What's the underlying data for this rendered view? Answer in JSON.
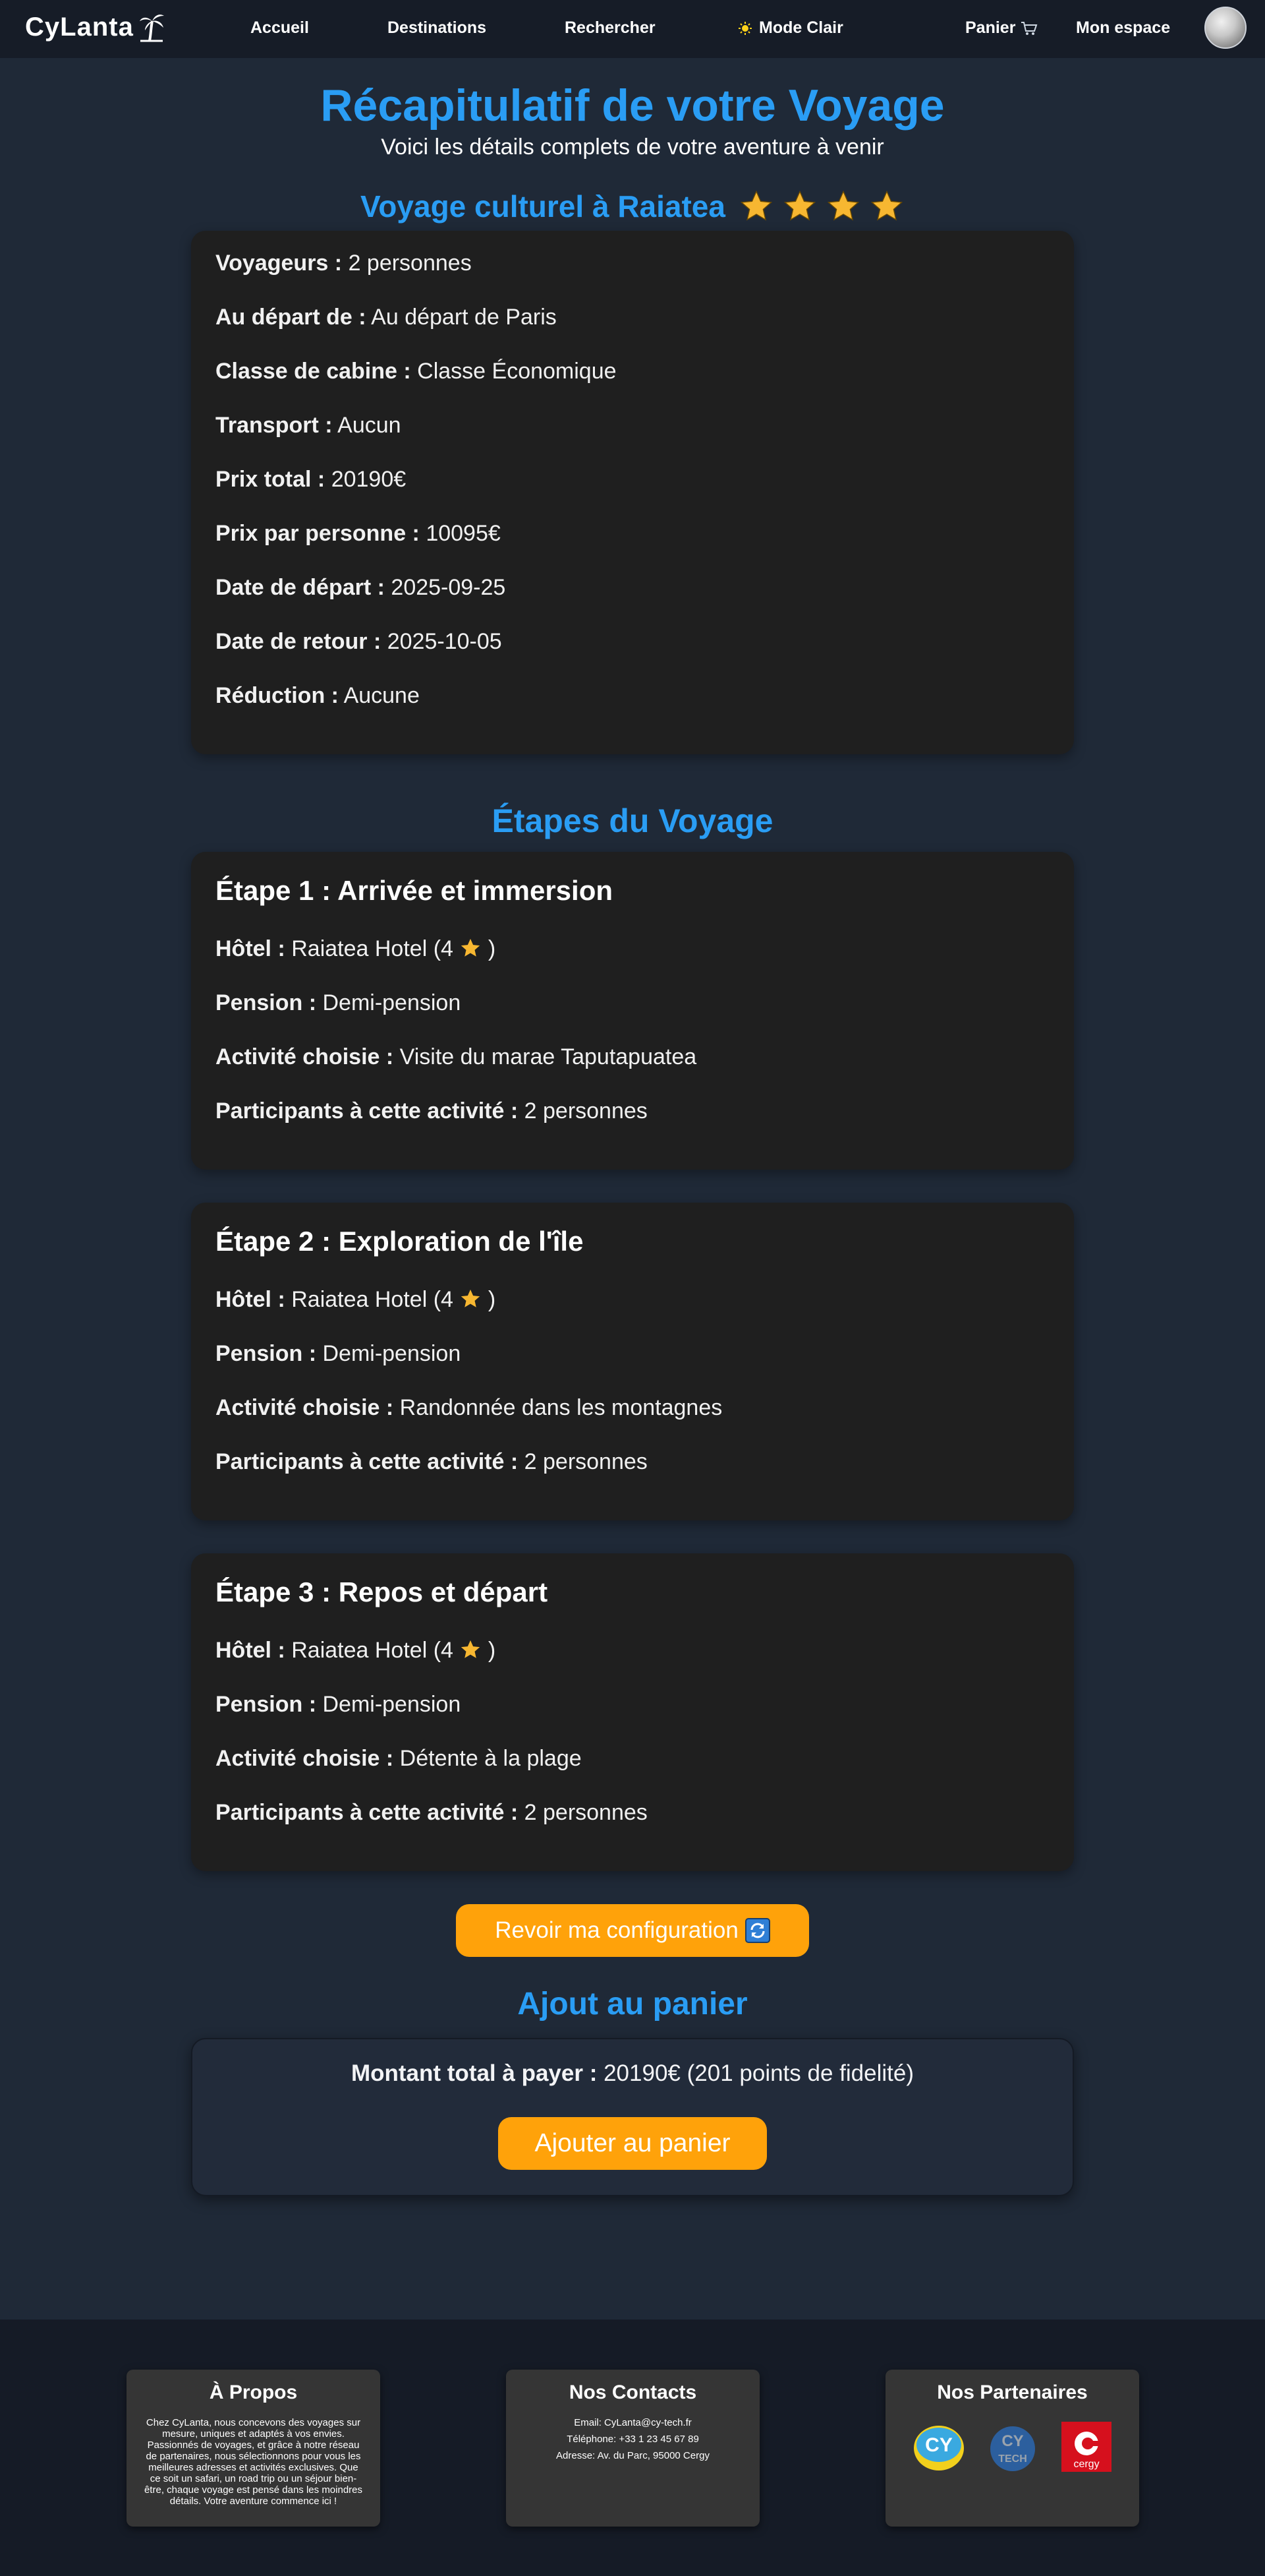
{
  "nav": {
    "logo": "CyLanta",
    "links": [
      "Accueil",
      "Destinations",
      "Rechercher"
    ],
    "mode": "Mode Clair",
    "cart": "Panier",
    "account": "Mon espace"
  },
  "header": {
    "title": "Récapitulatif de votre Voyage",
    "subtitle": "Voici les détails complets de votre aventure à venir"
  },
  "trip": {
    "name": "Voyage culturel à Raiatea",
    "rating": 4,
    "details": [
      {
        "label": "Voyageurs :",
        "value": "2 personnes"
      },
      {
        "label": "Au départ de :",
        "value": "Au départ de Paris"
      },
      {
        "label": "Classe de cabine :",
        "value": "Classe Économique"
      },
      {
        "label": "Transport :",
        "value": "Aucun"
      },
      {
        "label": "Prix total :",
        "value": "20190€"
      },
      {
        "label": "Prix par personne :",
        "value": "10095€"
      },
      {
        "label": "Date de départ :",
        "value": "2025-09-25"
      },
      {
        "label": "Date de retour :",
        "value": "2025-10-05"
      },
      {
        "label": "Réduction :",
        "value": "Aucune"
      }
    ]
  },
  "steps_section": {
    "title": "Étapes du Voyage",
    "labels": {
      "hotel": "Hôtel :",
      "pension": "Pension :",
      "activity": "Activité choisie :",
      "participants": "Participants à cette activité :"
    },
    "steps": [
      {
        "title": "Étape 1 : Arrivée et immersion",
        "hotel_prefix": "Raiatea Hotel (4",
        "hotel_suffix": ")",
        "pension": "Demi-pension",
        "activity": "Visite du marae Taputapuatea",
        "participants": "2 personnes"
      },
      {
        "title": "Étape 2 : Exploration de l'île",
        "hotel_prefix": "Raiatea Hotel (4",
        "hotel_suffix": ")",
        "pension": "Demi-pension",
        "activity": "Randonnée dans les montagnes",
        "participants": "2 personnes"
      },
      {
        "title": "Étape 3 : Repos et départ",
        "hotel_prefix": "Raiatea Hotel (4",
        "hotel_suffix": ")",
        "pension": "Demi-pension",
        "activity": "Détente à la plage",
        "participants": "2 personnes"
      }
    ]
  },
  "review_button": "Revoir ma configuration",
  "cart": {
    "title": "Ajout au panier",
    "total_label": "Montant total à payer :",
    "total_value": "20190€ (201 points de fidelité)",
    "add_button": "Ajouter au panier"
  },
  "footer": {
    "about_title": "À Propos",
    "about_text": "Chez CyLanta, nous concevons des voyages sur mesure, uniques et adaptés à vos envies. Passionnés de voyages, et grâce à notre réseau de partenaires, nous sélectionnons pour vous les meilleures adresses et activités exclusives. Que ce soit un safari, un road trip ou un séjour bien-être, chaque voyage est pensé dans les moindres détails. Votre aventure commence ici !",
    "contacts_title": "Nos Contacts",
    "email": "Email: CyLanta@cy-tech.fr",
    "phone": "Téléphone: +33 1 23 45 67 89",
    "address": "Adresse: Av. du Parc, 95000 Cergy",
    "partners_title": "Nos Partenaires",
    "partners": [
      "CY",
      "CY TECH",
      "cergy"
    ]
  },
  "colors": {
    "accent": "#2a9df4",
    "button": "#ffa20a",
    "star": "#f7b731",
    "background": "#1f2937"
  }
}
